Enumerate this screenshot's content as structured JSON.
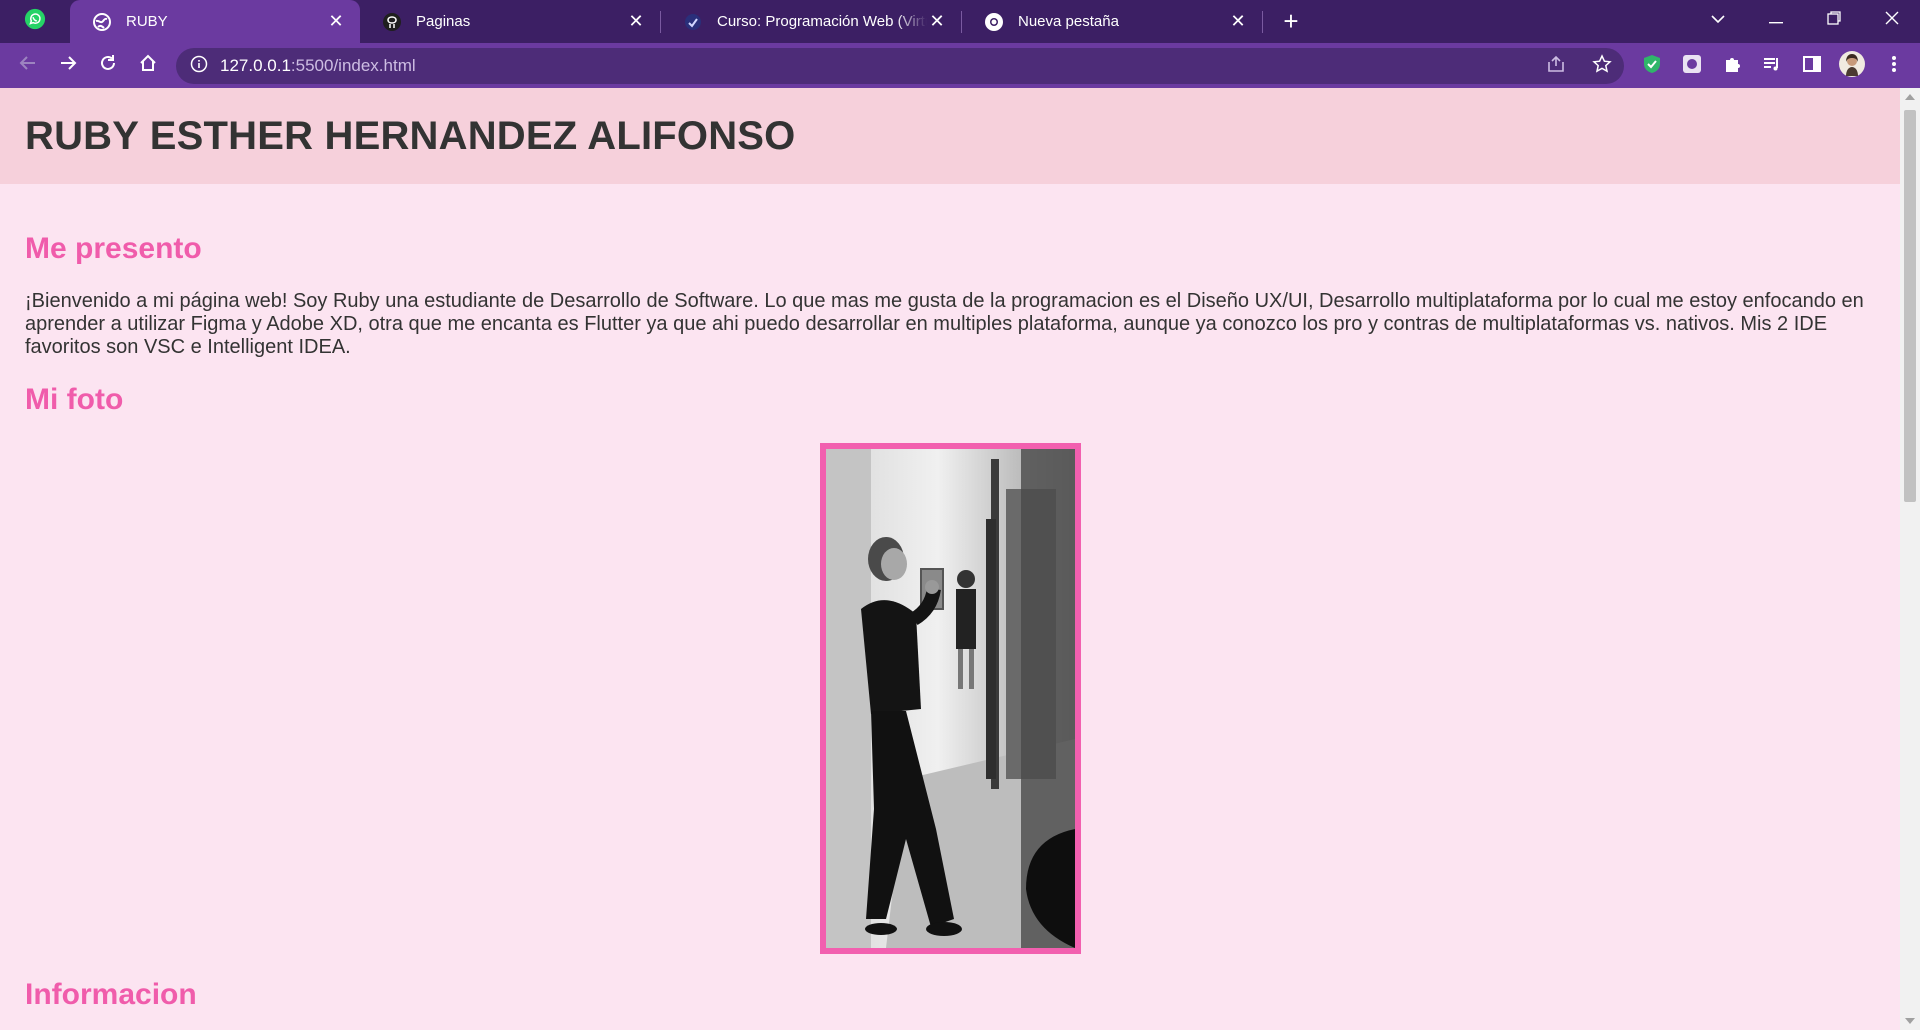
{
  "browser": {
    "tabs": [
      {
        "label": "RUBY",
        "active": true,
        "icon": "globe-icon"
      },
      {
        "label": "Paginas",
        "active": false,
        "icon": "github-icon"
      },
      {
        "label": "Curso: Programación Web (Virtua",
        "active": false,
        "icon": "course-icon"
      },
      {
        "label": "Nueva pestaña",
        "active": false,
        "icon": "chrome-icon"
      }
    ],
    "url_host": "127.0.0.1",
    "url_path": ":5500/index.html",
    "colors": {
      "tabstrip": "#3c1f64",
      "toolbar": "#6b3aa0",
      "omnibox": "#4d2c78"
    }
  },
  "page": {
    "header_title": "RUBY ESTHER HERNANDEZ ALIFONSO",
    "sections": [
      {
        "title": "Me presento",
        "text": "¡Bienvenido a mi página web! Soy Ruby una estudiante de Desarrollo de Software. Lo que mas me gusta de la programacion es el Diseño UX/UI, Desarrollo multiplataforma por lo cual me estoy enfocando en aprender a utilizar Figma y Adobe XD, otra que me encanta es Flutter ya que ahi puedo desarrollar en multiples plataforma, aunque ya conozco los pro y contras de multiplataformas vs. nativos. Mis 2 IDE favoritos son VSC e Intelligent IDEA."
      },
      {
        "title": "Mi foto"
      },
      {
        "title": "Informacion"
      }
    ],
    "colors": {
      "background": "#fce4f1",
      "header": "#f6d0db",
      "heading": "#f05cab",
      "text": "#333333",
      "photo_border": "#f25faf"
    }
  }
}
